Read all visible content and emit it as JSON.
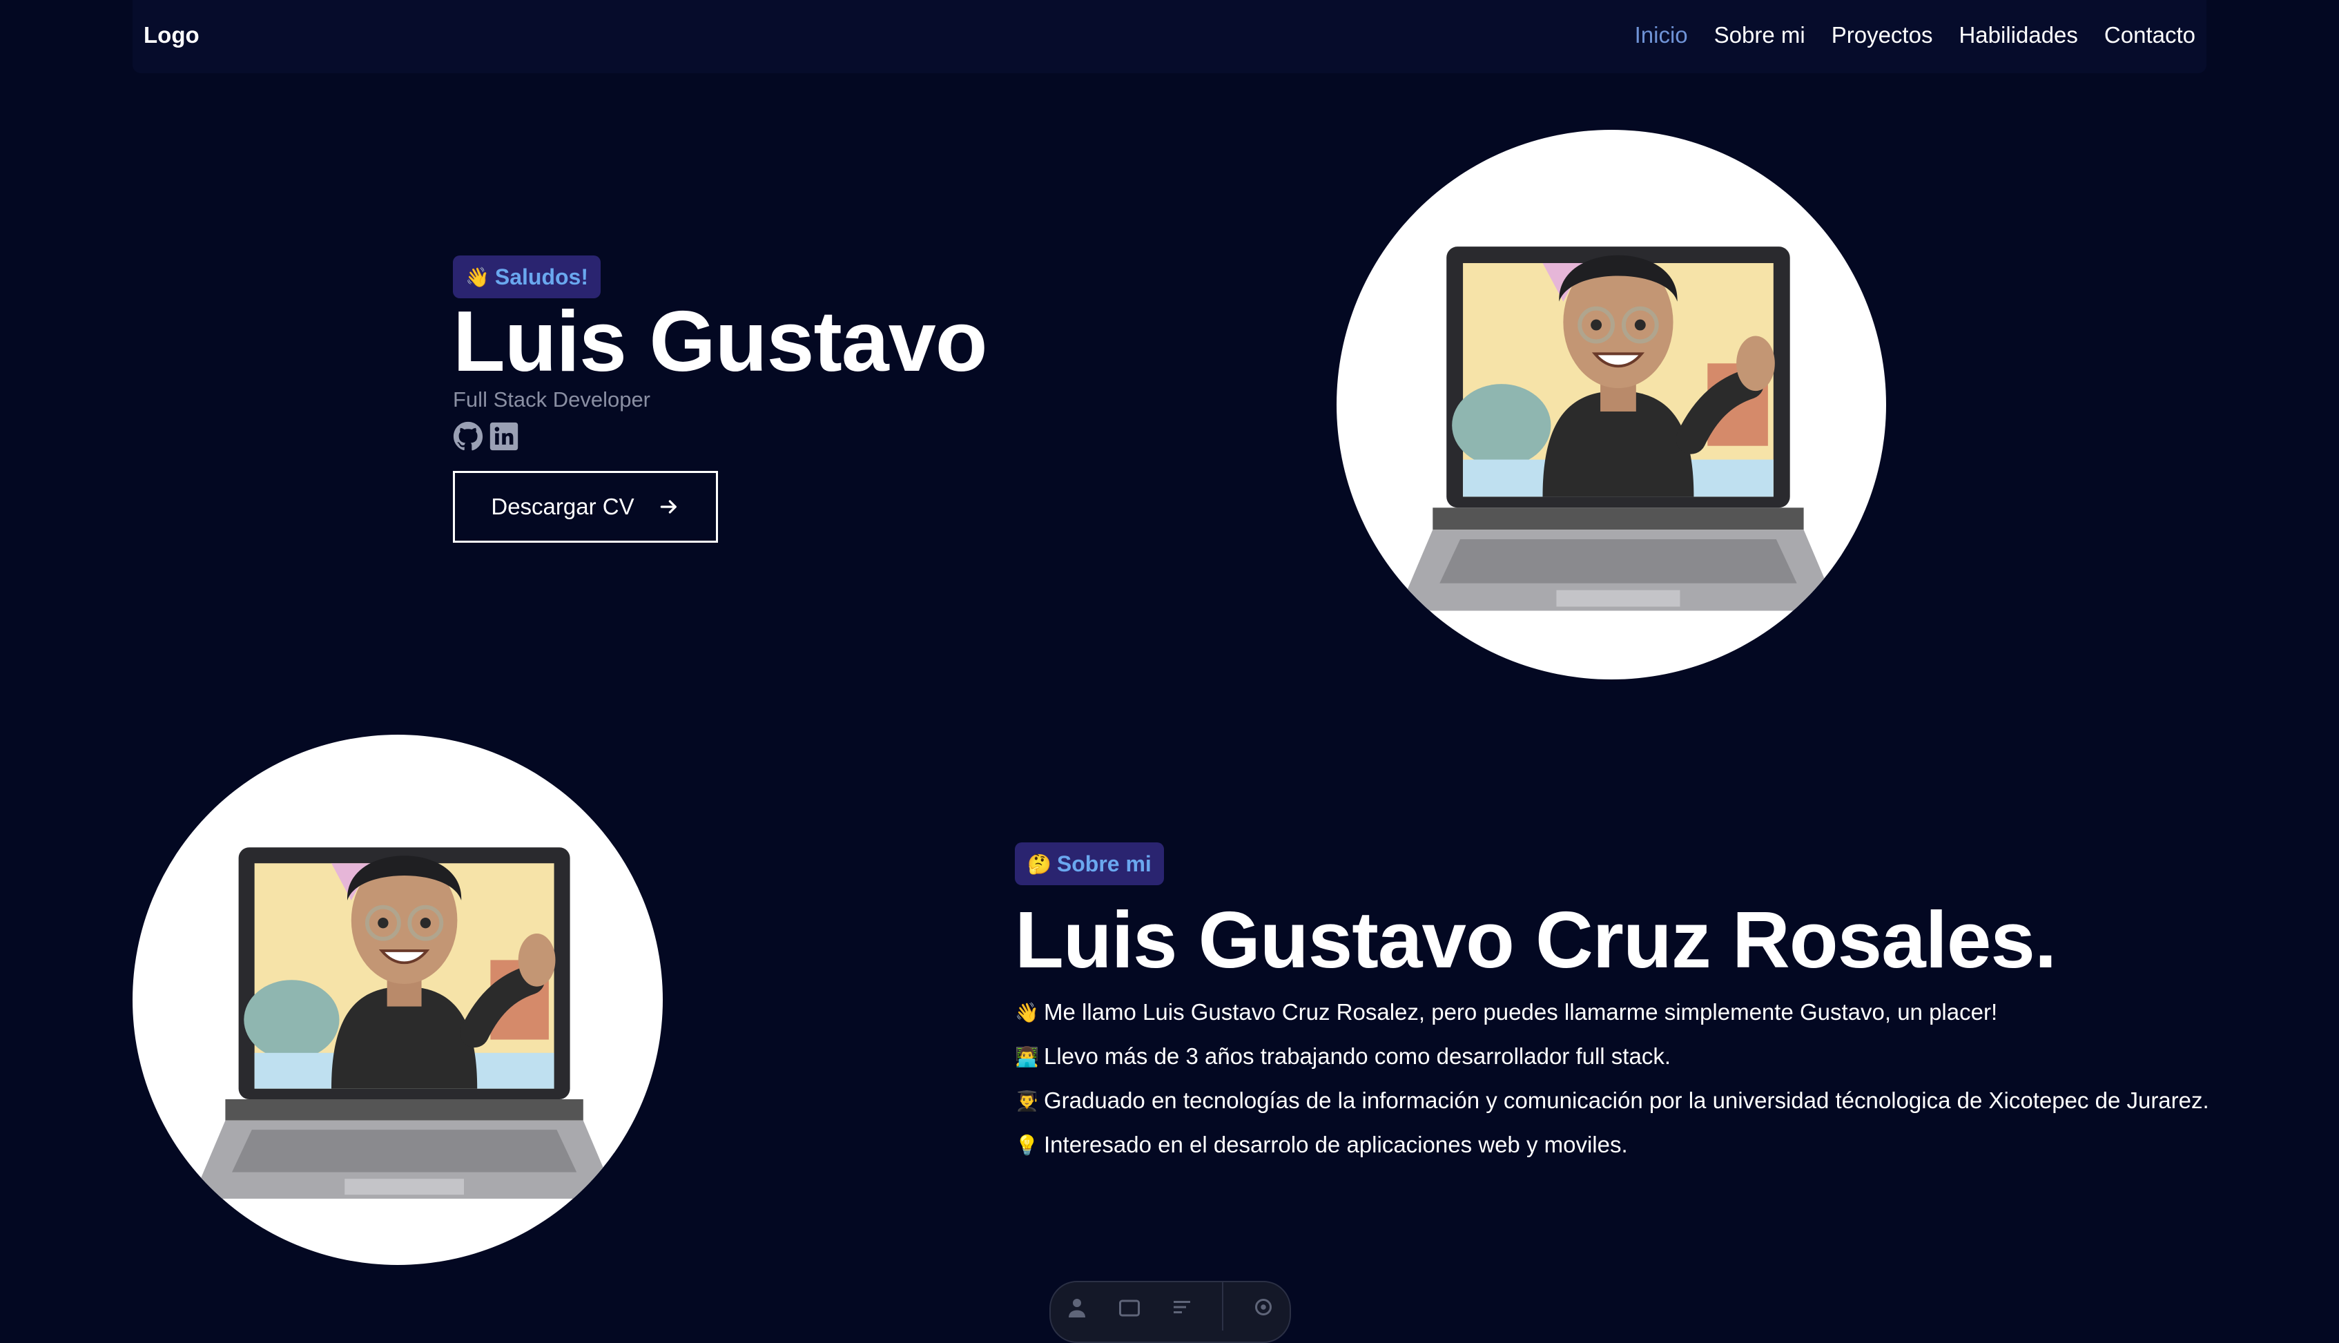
{
  "nav": {
    "logo": "Logo",
    "links": [
      "Inicio",
      "Sobre mi",
      "Proyectos",
      "Habilidades",
      "Contacto"
    ],
    "active_index": 0
  },
  "hero": {
    "badge_emoji": "👋",
    "badge_text": "Saludos!",
    "title": "Luis Gustavo",
    "subtitle": "Full Stack Developer",
    "socials": [
      "github-icon",
      "linkedin-icon"
    ],
    "cta_label": "Descargar CV",
    "cta_icon": "arrow-right-icon"
  },
  "about": {
    "badge_emoji": "🤔",
    "badge_text": "Sobre mi",
    "title": "Luis Gustavo Cruz Rosales.",
    "items": [
      {
        "icon": "👋",
        "text": "Me llamo Luis Gustavo Cruz Rosalez, pero puedes llamarme simplemente Gustavo, un placer!"
      },
      {
        "icon": "👨‍💻",
        "text": "Llevo más de 3 años trabajando como desarrollador full stack."
      },
      {
        "icon": "👨‍🎓",
        "text": "Graduado en tecnologías de la información y comunicación por la universidad técnologica de Xicotepec de Jurarez."
      },
      {
        "icon": "💡",
        "text": "Interesado en el desarrolo de aplicaciones web y moviles."
      }
    ]
  },
  "colors": {
    "background": "#030822",
    "navbar": "#060c2b",
    "badge_bg": "#2a2470",
    "badge_text": "#6aa8ef",
    "nav_active": "#6f93d6"
  }
}
